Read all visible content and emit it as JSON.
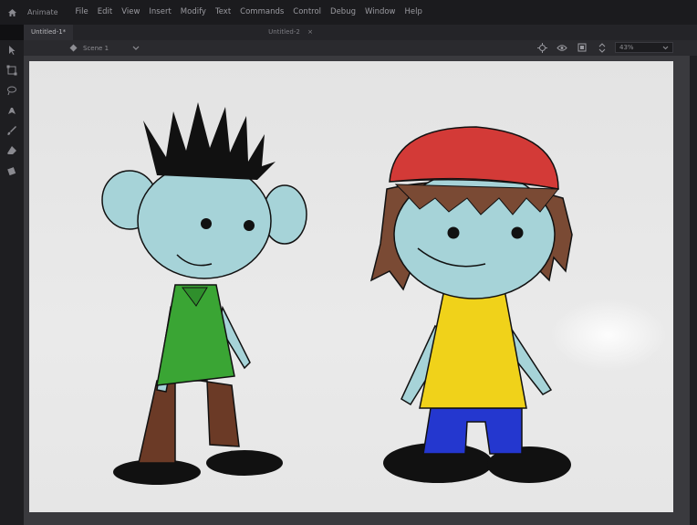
{
  "workspace_label": "Animate",
  "menu": [
    "File",
    "Edit",
    "View",
    "Insert",
    "Modify",
    "Text",
    "Commands",
    "Control",
    "Debug",
    "Window",
    "Help"
  ],
  "tabs": [
    {
      "label": "Untitled-1*",
      "active": true
    },
    {
      "label": "Untitled-2",
      "active": false
    }
  ],
  "scene_label": "Scene 1",
  "zoom": "43%",
  "colors": {
    "skin": "#a6d3d8",
    "outline": "#111111",
    "green_shirt": "#3aa534",
    "brown_pants": "#6b3a26",
    "red_cap": "#d33a37",
    "brown_hair": "#7a4a34",
    "yellow_shirt": "#f0d21a",
    "blue_pants": "#2437cf"
  },
  "icons": [
    "home-icon",
    "scene-icon",
    "camera-icon",
    "eye-icon",
    "fit-icon",
    "stepper-icon",
    "chevron-down-icon",
    "arrow-tool-icon",
    "free-transform-icon",
    "lasso-icon",
    "pen-icon",
    "brush-icon",
    "eraser-icon",
    "paint-bucket-icon"
  ]
}
